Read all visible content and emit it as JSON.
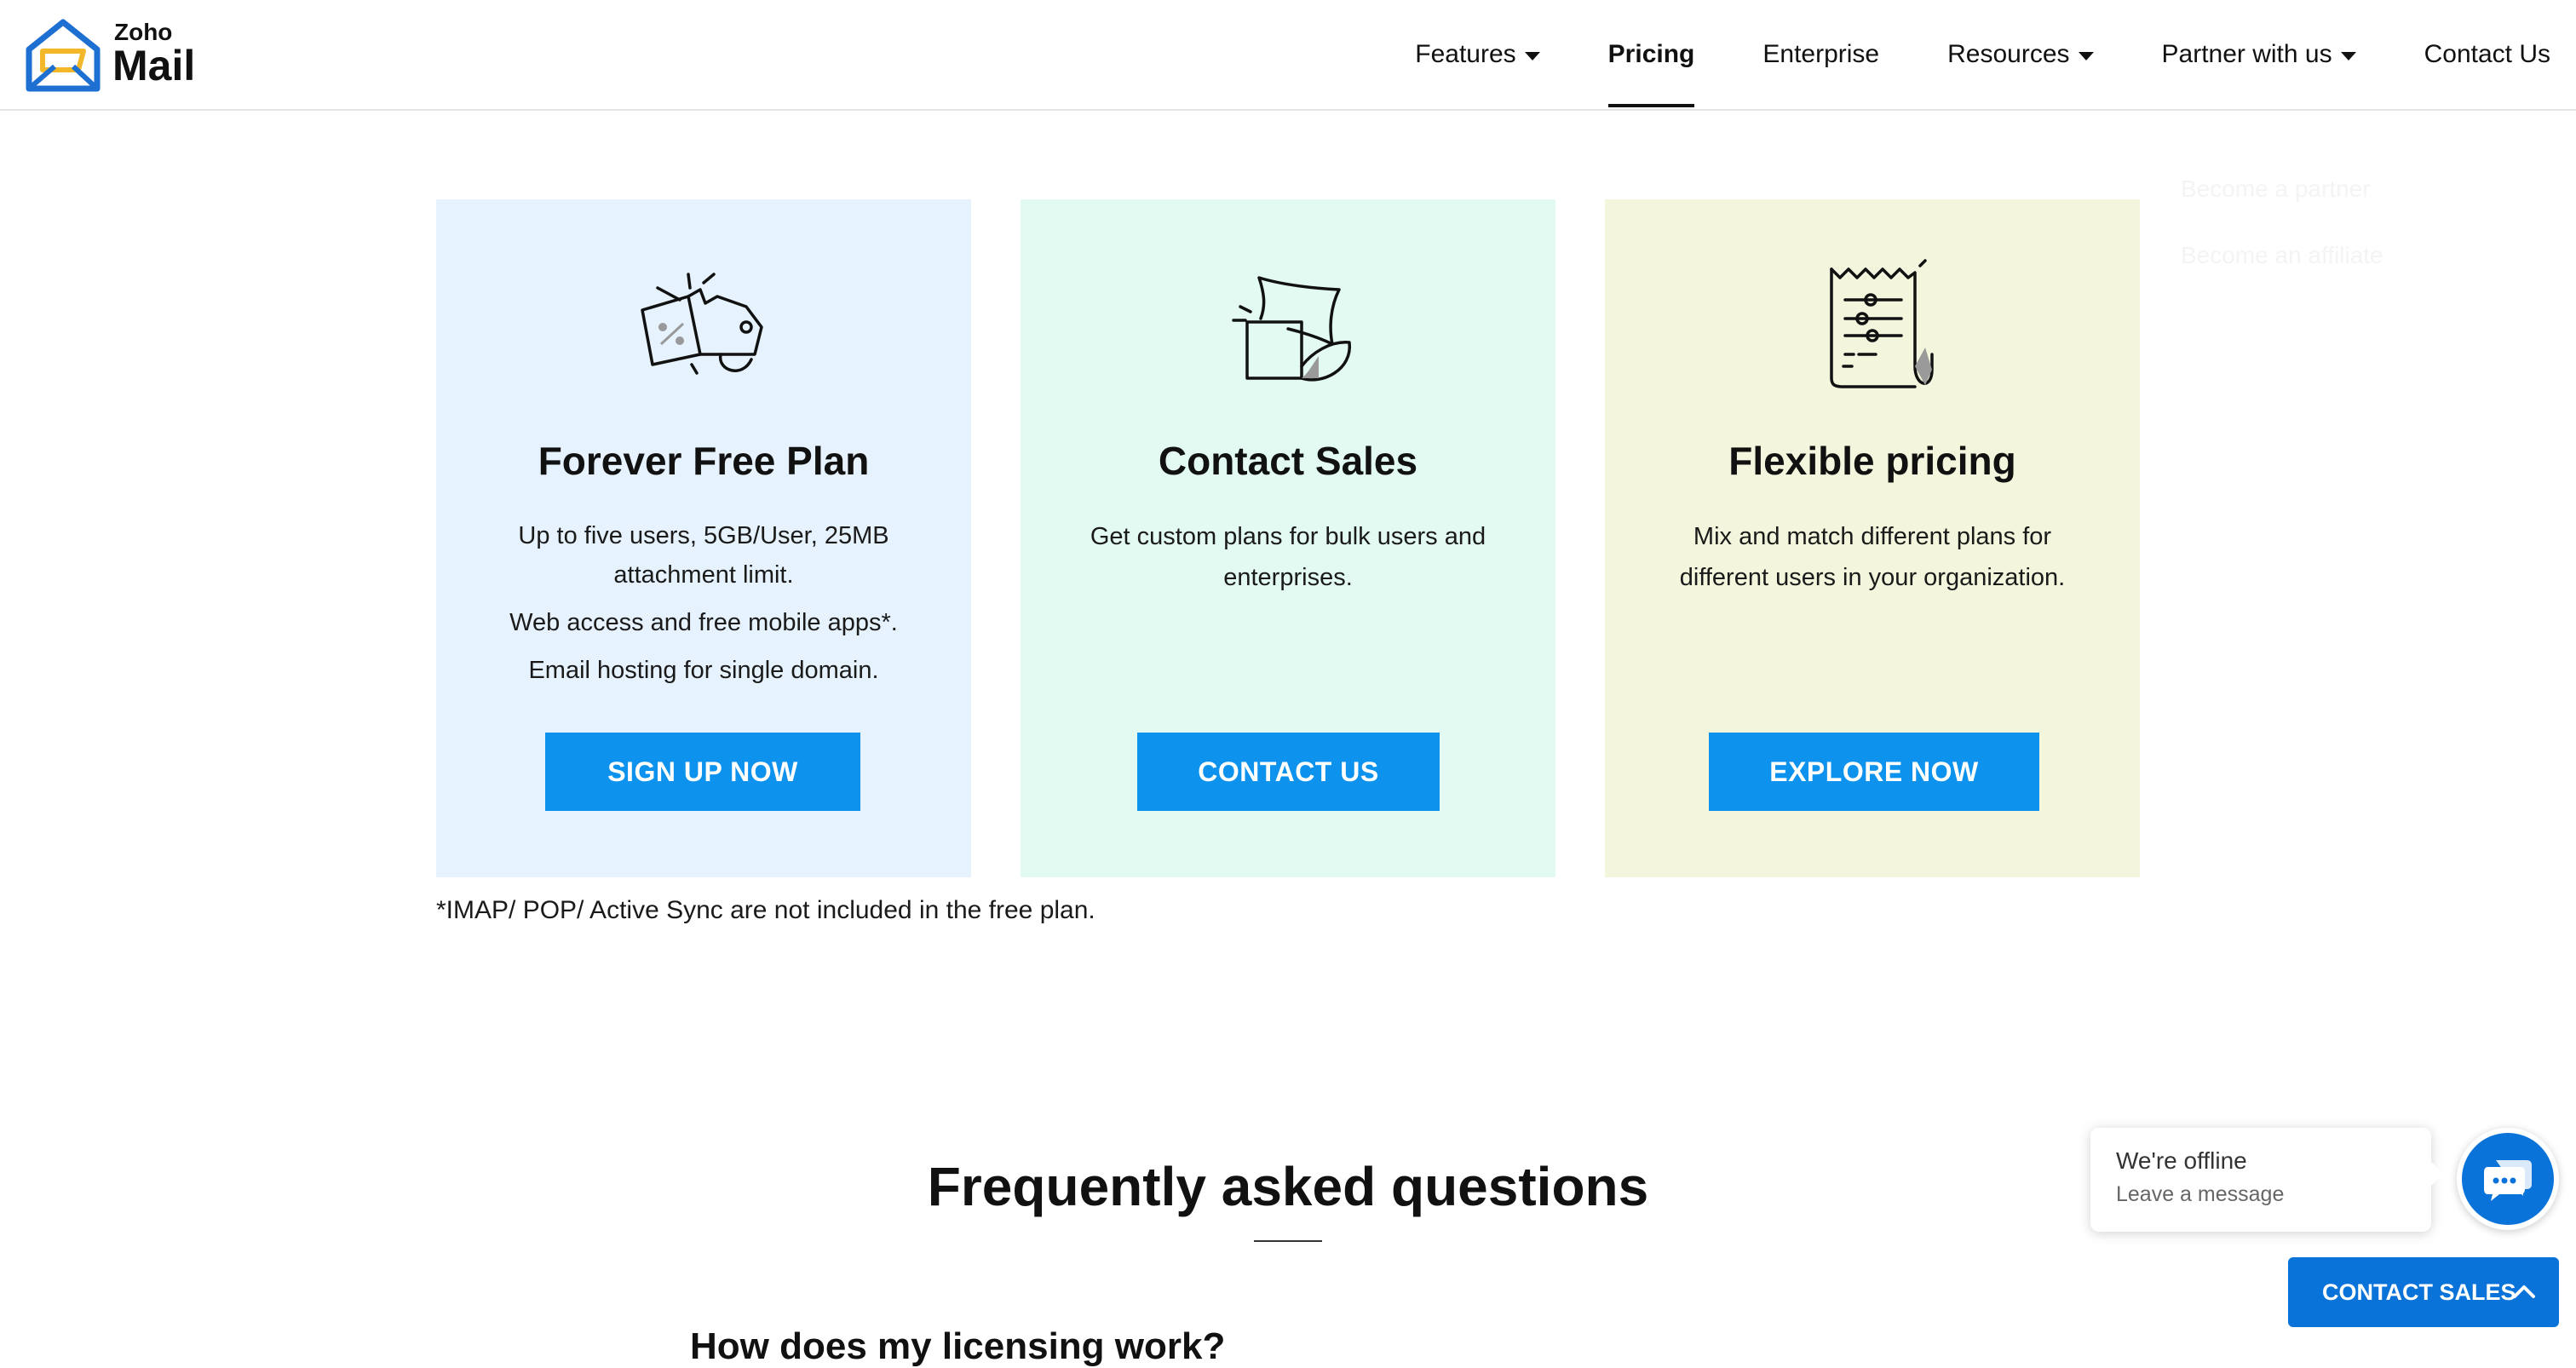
{
  "logo": {
    "small": "Zoho",
    "big": "Mail",
    "icon": "zoho-mail-envelope-logo",
    "colors": {
      "blue": "#1d6fd1",
      "yellow": "#f3b82a"
    }
  },
  "nav": {
    "items": [
      {
        "label": "Features",
        "has_dropdown": true
      },
      {
        "label": "Pricing",
        "active": true
      },
      {
        "label": "Enterprise"
      },
      {
        "label": "Resources",
        "has_dropdown": true
      },
      {
        "label": "Partner with us",
        "has_dropdown": true
      },
      {
        "label": "Contact Us"
      }
    ]
  },
  "cards": [
    {
      "icon": "price-tag-icon",
      "title": "Forever Free Plan",
      "lines": [
        "Up to five users, 5GB/User, 25MB attachment limit.",
        "Web access and free mobile apps*.",
        "Email hosting for single domain."
      ],
      "button": "SIGN UP NOW",
      "bg": "#e6f2fd"
    },
    {
      "icon": "shapes-icon",
      "title": "Contact Sales",
      "lines": [
        "Get custom plans for bulk users and enterprises."
      ],
      "button": "CONTACT US",
      "bg": "#e2faf2"
    },
    {
      "icon": "receipt-sliders-icon",
      "title": "Flexible pricing",
      "lines": [
        "Mix and match different plans for different users in your organization."
      ],
      "button": "EXPLORE NOW",
      "bg": "#f3f6dc"
    }
  ],
  "button_color": "#0d93ee",
  "footnote": "*IMAP/ POP/ Active Sync are not included in the free plan.",
  "faded_menu": [
    "Become a partner",
    "Become an affiliate"
  ],
  "faq": {
    "title": "Frequently asked questions",
    "peek": "How does my licensing work?"
  },
  "chat": {
    "status": "We're offline",
    "sub": "Leave a message",
    "launcher_icon": "chat-icon",
    "contact_sales": "CONTACT SALES",
    "accent": "#0a73d9"
  }
}
